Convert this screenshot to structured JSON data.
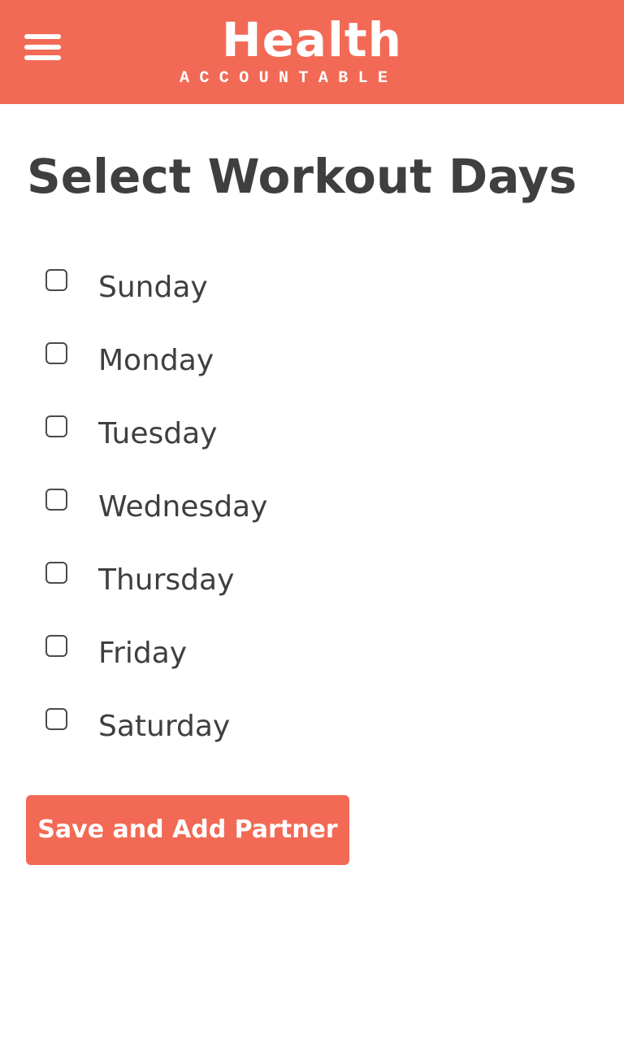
{
  "header": {
    "menu_icon": "hamburger-menu-icon",
    "brand_title": "Health",
    "brand_subtitle": "ACCOUNTABLE",
    "background_color": "#f26a55"
  },
  "main": {
    "title": "Select Workout Days",
    "days": [
      {
        "label": "Sunday",
        "checked": false
      },
      {
        "label": "Monday",
        "checked": false
      },
      {
        "label": "Tuesday",
        "checked": false
      },
      {
        "label": "Wednesday",
        "checked": false
      },
      {
        "label": "Thursday",
        "checked": false
      },
      {
        "label": "Friday",
        "checked": false
      },
      {
        "label": "Saturday",
        "checked": false
      }
    ],
    "save_button_label": "Save and Add Partner"
  },
  "colors": {
    "accent": "#f26a55",
    "text": "#3f3f3f",
    "background": "#ffffff"
  }
}
